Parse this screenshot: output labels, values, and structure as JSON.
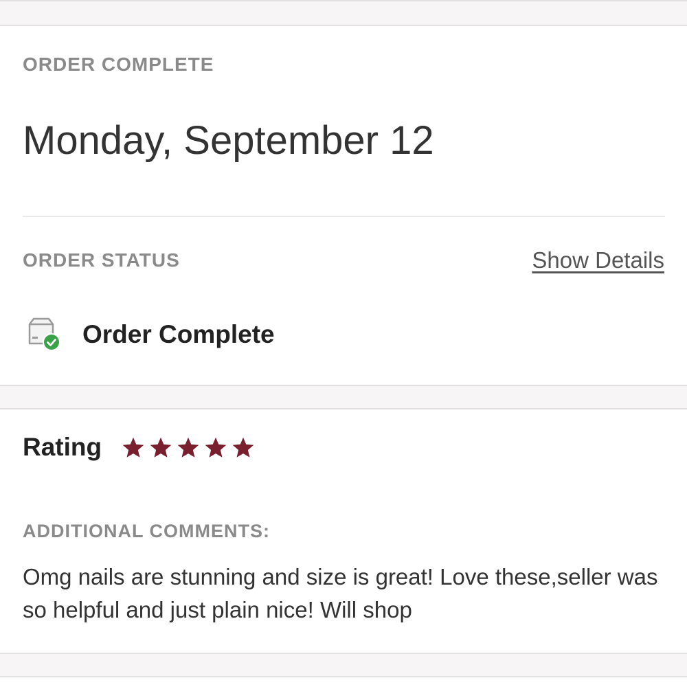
{
  "order": {
    "eyebrow": "ORDER COMPLETE",
    "date": "Monday, September 12",
    "status_eyebrow": "ORDER STATUS",
    "show_details": "Show Details",
    "status_icon": "package-check-icon",
    "status_label": "Order Complete"
  },
  "review": {
    "rating_label": "Rating",
    "rating_value": 5,
    "rating_max": 5,
    "star_icon": "star-icon",
    "comments_eyebrow": "ADDITIONAL COMMENTS:",
    "comment_text": "Omg nails are stunning and size is great! Love these,seller was so helpful and just plain nice! Will shop"
  },
  "colors": {
    "star": "#7a1f2e",
    "success": "#3aa34a",
    "muted_text": "#8a8a8a"
  }
}
